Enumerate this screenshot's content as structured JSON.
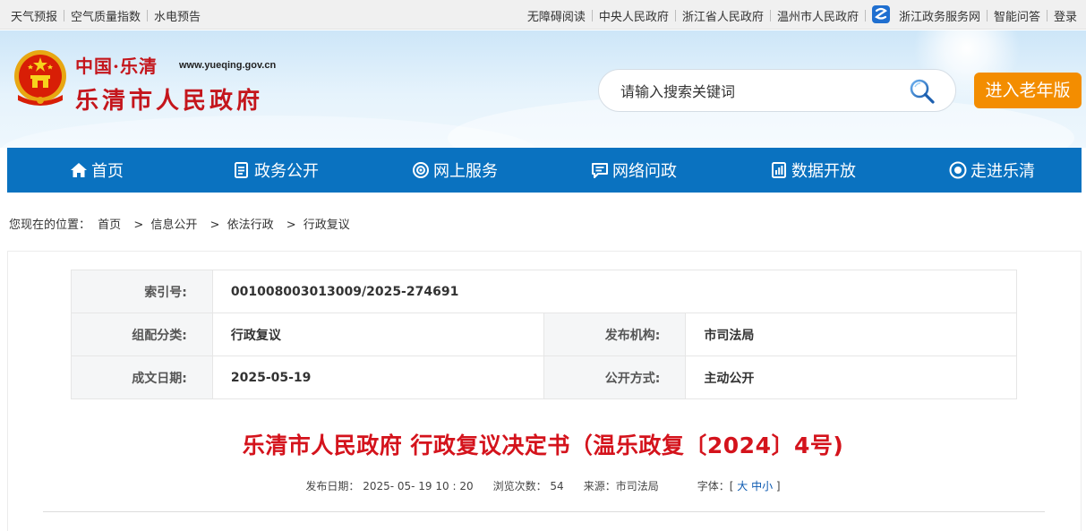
{
  "topbar": {
    "left_links": [
      "天气预报",
      "空气质量指数",
      "水电预告"
    ],
    "right_links": [
      "无障碍阅读",
      "中央人民政府",
      "浙江省人民政府",
      "温州市人民政府"
    ],
    "right_links_2": [
      "浙江政务服务网",
      "智能问答",
      "登录"
    ]
  },
  "header": {
    "logo_cn": "中国·乐清",
    "logo_url": "www.yueqing.gov.cn",
    "logo_name": "乐清市人民政府",
    "search_placeholder": "请输入搜索关键词",
    "elder_button": "进入老年版"
  },
  "nav": [
    {
      "label": "首页",
      "icon": "home-icon"
    },
    {
      "label": "政务公开",
      "icon": "document-icon"
    },
    {
      "label": "网上服务",
      "icon": "service-icon"
    },
    {
      "label": "网络问政",
      "icon": "chat-icon"
    },
    {
      "label": "数据开放",
      "icon": "data-icon"
    },
    {
      "label": "走进乐清",
      "icon": "eye-icon"
    }
  ],
  "breadcrumb": {
    "prefix": "您现在的位置：",
    "items": [
      "首页",
      "信息公开",
      "依法行政",
      "行政复议"
    ]
  },
  "meta": {
    "index_label": "索引号:",
    "index_value": "001008003013009/2025-274691",
    "category_label": "组配分类:",
    "category_value": "行政复议",
    "publisher_label": "发布机构:",
    "publisher_value": "市司法局",
    "date_label": "成文日期:",
    "date_value": "2025-05-19",
    "disclosure_label": "公开方式:",
    "disclosure_value": "主动公开"
  },
  "document": {
    "title": "乐清市人民政府 行政复议决定书（温乐政复〔2024〕4号)",
    "publish_date": "发布日期： 2025- 05- 19 10 : 20",
    "views": "浏览次数： 54",
    "source": "来源：市司法局",
    "font_label": "字体：[",
    "font_large": "大",
    "font_medium": "中",
    "font_small": "小",
    "font_close": "]"
  },
  "colors": {
    "nav_bg": "#0a72c0",
    "title_red": "#d4131c",
    "elder_orange": "#f38d00"
  }
}
